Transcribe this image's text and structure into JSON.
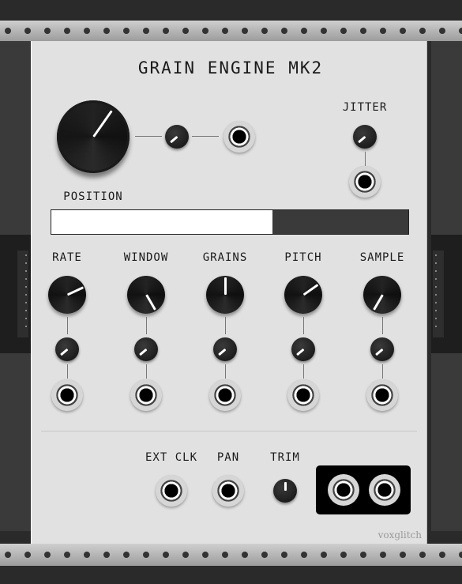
{
  "module": {
    "title": "GRAIN ENGINE MK2",
    "brand": "voxglitch",
    "position_label": "POSITION",
    "position_value": 0.62,
    "jitter_label": "JITTER",
    "columns": [
      {
        "label": "RATE"
      },
      {
        "label": "WINDOW"
      },
      {
        "label": "GRAINS"
      },
      {
        "label": "PITCH"
      },
      {
        "label": "SAMPLE"
      }
    ],
    "bottom": {
      "ext_clk_label": "EXT CLK",
      "pan_label": "PAN",
      "trim_label": "TRIM"
    }
  }
}
